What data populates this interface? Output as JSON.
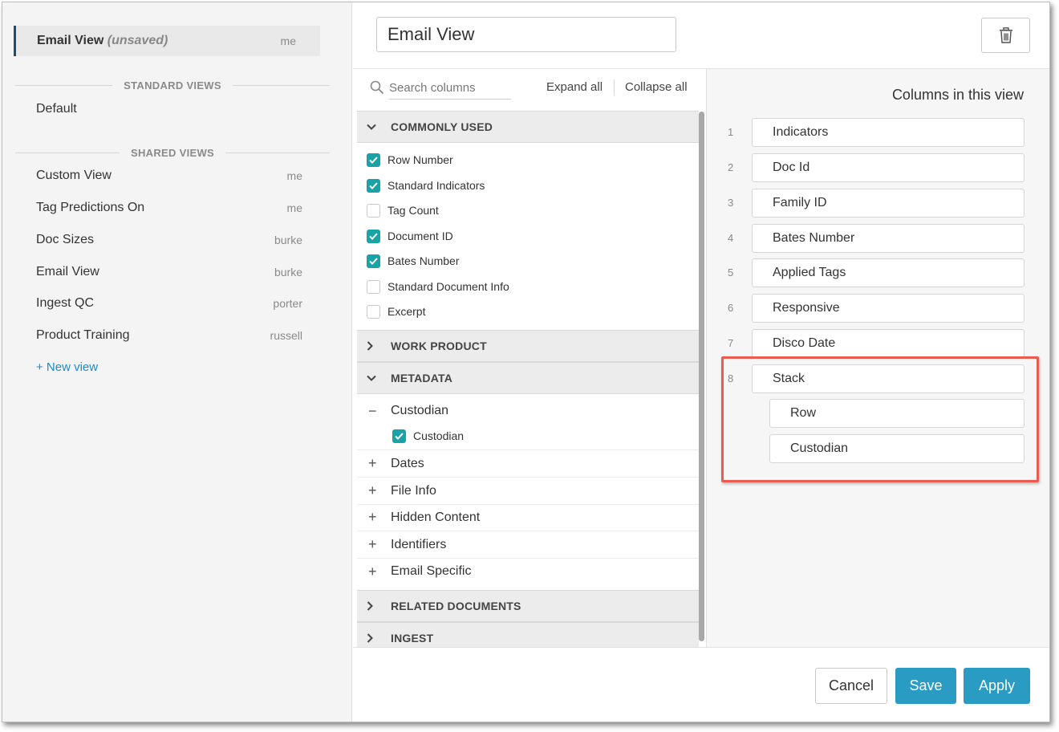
{
  "sidebar": {
    "current_view": {
      "name": "Email View",
      "status": "(unsaved)",
      "owner": "me"
    },
    "standard_views_heading": "STANDARD VIEWS",
    "standard_views": [
      {
        "name": "Default"
      }
    ],
    "shared_views_heading": "SHARED VIEWS",
    "shared_views": [
      {
        "name": "Custom View",
        "owner": "me"
      },
      {
        "name": "Tag Predictions On",
        "owner": "me"
      },
      {
        "name": "Doc Sizes",
        "owner": "burke"
      },
      {
        "name": "Email View",
        "owner": "burke"
      },
      {
        "name": "Ingest QC",
        "owner": "porter"
      },
      {
        "name": "Product Training",
        "owner": "russell"
      }
    ],
    "new_view_label": "+ New view"
  },
  "header": {
    "view_name": "Email View",
    "delete_icon": "trash-icon"
  },
  "columns_picker": {
    "search_placeholder": "Search columns",
    "expand_all": "Expand all",
    "collapse_all": "Collapse all",
    "groups": {
      "commonly_used": {
        "label": "COMMONLY USED",
        "expanded": true,
        "items": [
          {
            "label": "Row Number",
            "checked": true
          },
          {
            "label": "Standard Indicators",
            "checked": true
          },
          {
            "label": "Tag Count",
            "checked": false
          },
          {
            "label": "Document ID",
            "checked": true
          },
          {
            "label": "Bates Number",
            "checked": true
          },
          {
            "label": "Standard Document Info",
            "checked": false
          },
          {
            "label": "Excerpt",
            "checked": false
          }
        ]
      },
      "work_product": {
        "label": "WORK PRODUCT",
        "expanded": false
      },
      "metadata": {
        "label": "METADATA",
        "expanded": true,
        "custodian": {
          "label": "Custodian",
          "expanded": true,
          "child": {
            "label": "Custodian",
            "checked": true
          }
        },
        "subgroups": [
          {
            "label": "Dates"
          },
          {
            "label": "File Info"
          },
          {
            "label": "Hidden Content"
          },
          {
            "label": "Identifiers"
          },
          {
            "label": "Email Specific"
          }
        ]
      },
      "related_documents": {
        "label": "RELATED DOCUMENTS",
        "expanded": false
      },
      "ingest": {
        "label": "INGEST",
        "expanded": false
      }
    }
  },
  "view_columns": {
    "title": "Columns in this view",
    "columns": [
      {
        "num": "1",
        "label": "Indicators"
      },
      {
        "num": "2",
        "label": "Doc Id"
      },
      {
        "num": "3",
        "label": "Family ID"
      },
      {
        "num": "4",
        "label": "Bates Number"
      },
      {
        "num": "5",
        "label": "Applied Tags"
      },
      {
        "num": "6",
        "label": "Responsive"
      },
      {
        "num": "7",
        "label": "Disco Date"
      },
      {
        "num": "8",
        "label": "Stack",
        "children": [
          {
            "label": "Row"
          },
          {
            "label": "Custodian"
          }
        ]
      }
    ]
  },
  "footer": {
    "cancel": "Cancel",
    "save": "Save",
    "apply": "Apply"
  },
  "colors": {
    "accent": "#2a9cc4",
    "checkbox": "#1aa3a6",
    "highlight": "#ec5b4f",
    "active_marker": "#1d4e6e"
  }
}
